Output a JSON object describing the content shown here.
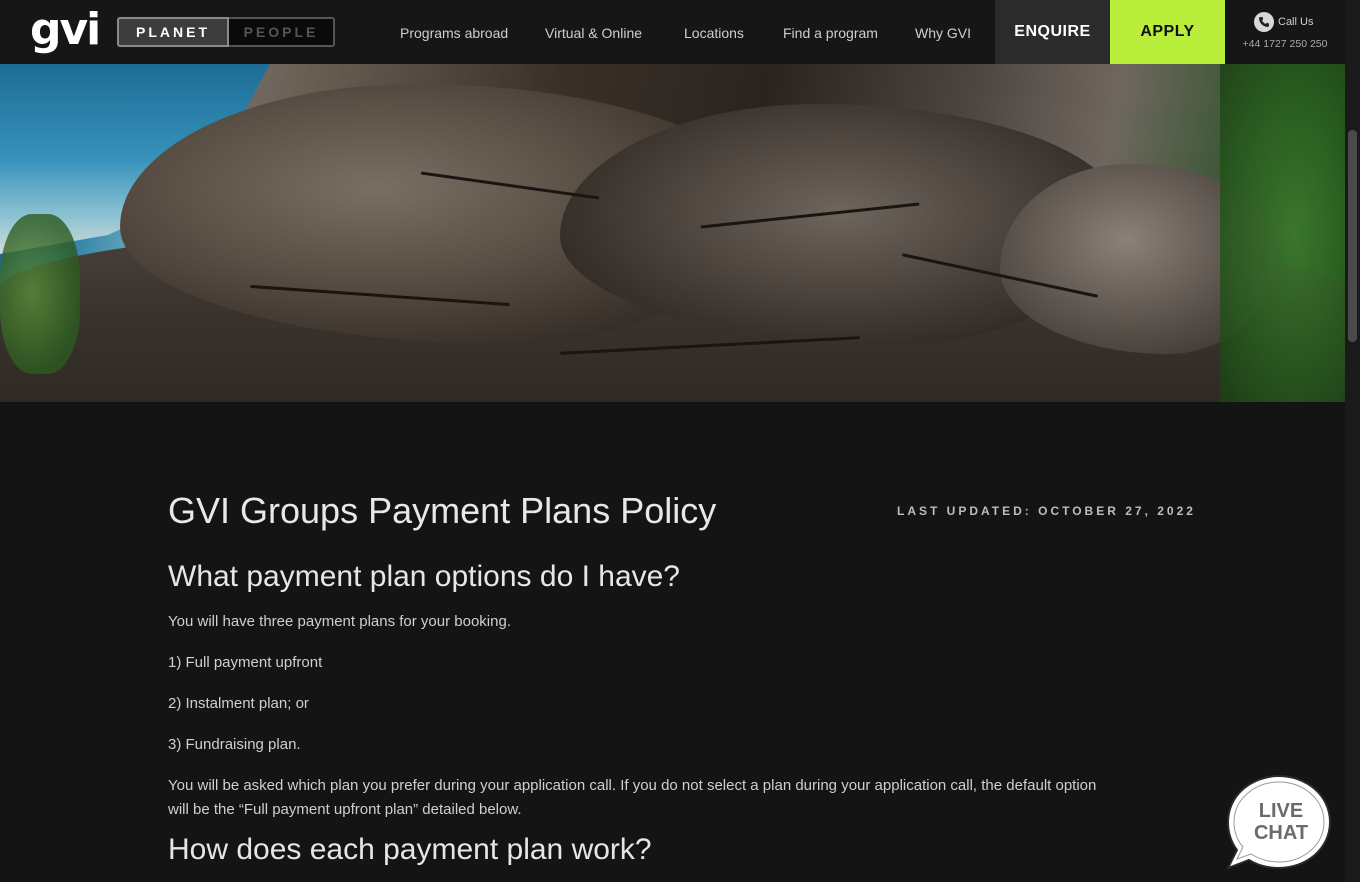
{
  "header": {
    "logo_text": "gvi",
    "toggle": {
      "active": "PLANET",
      "inactive": "PEOPLE"
    },
    "menu": [
      "Programs abroad",
      "Virtual & Online",
      "Locations",
      "Find a program",
      "Why GVI"
    ],
    "enquire_label": "ENQUIRE",
    "apply_label": "APPLY",
    "call": {
      "label": "Call Us",
      "number": "+44 1727 250 250"
    },
    "colors": {
      "apply_bg": "#b9ef3b",
      "enquire_bg": "#2b2b2b",
      "nav_bg": "#161616"
    }
  },
  "page": {
    "title": "GVI Groups Payment Plans Policy",
    "last_updated": "LAST UPDATED: OCTOBER 27, 2022",
    "section1": {
      "heading": "What payment plan options do I have?",
      "intro": "You will have three payment plans for your booking.",
      "options": [
        "1) Full payment upfront",
        "2) Instalment plan; or",
        "3) Fundraising plan."
      ],
      "note": "You will be asked which plan you prefer during your application call. If you do not select a plan during your application call, the default option will be the “Full payment upfront plan” detailed below."
    },
    "section2": {
      "heading": "How does each payment plan work?"
    }
  },
  "livechat": {
    "line1": "LIVE",
    "line2": "CHAT"
  },
  "icons": {
    "phone": "phone-icon",
    "chat": "chat-bubble-icon"
  }
}
